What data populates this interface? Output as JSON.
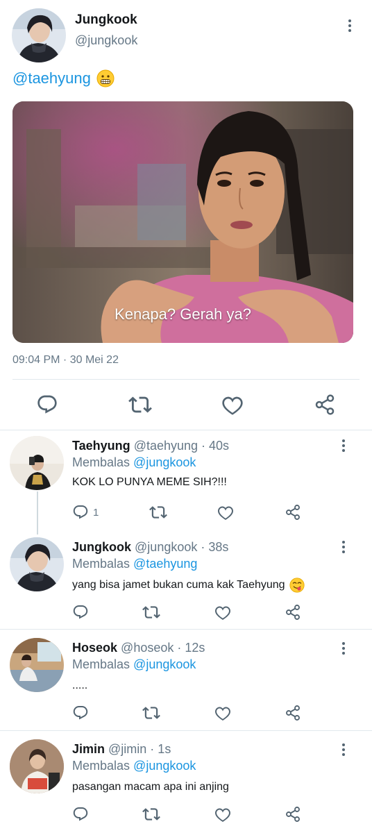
{
  "main_tweet": {
    "name": "Jungkook",
    "handle": "@jungkook",
    "text": "@taehyung",
    "text_emoji": "grimacing-face-icon",
    "media_caption": "Kenapa? Gerah ya?",
    "timestamp": "09:04 PM · 30 Mei 22",
    "actions": [
      "reply-icon",
      "retweet-icon",
      "like-icon",
      "share-icon"
    ]
  },
  "replies": [
    {
      "name": "Taehyung",
      "handle_time": "@taehyung · 40s",
      "replying_prefix": "Membalas",
      "replying_to": "@jungkook",
      "text": "KOK LO PUNYA MEME SIH?!!!",
      "reply_count": "1"
    },
    {
      "name": "Jungkook",
      "handle_time": "@jungkook · 38s",
      "replying_prefix": "Membalas",
      "replying_to": "@taehyung",
      "text": "yang bisa jamet bukan cuma kak Taehyung",
      "text_emoji": "savoring-food-face-icon",
      "reply_count": ""
    },
    {
      "name": "Hoseok",
      "handle_time": "@hoseok · 12s",
      "replying_prefix": "Membalas",
      "replying_to": "@jungkook",
      "text": ".....",
      "reply_count": ""
    },
    {
      "name": "Jimin",
      "handle_time": "@jimin · 1s",
      "replying_prefix": "Membalas",
      "replying_to": "@jungkook",
      "text": "pasangan macam apa ini anjing",
      "reply_count": ""
    }
  ],
  "colors": {
    "link": "#1b95e0",
    "secondary_text": "#657786",
    "divider": "#e1e8ed",
    "icon": "#536471"
  }
}
